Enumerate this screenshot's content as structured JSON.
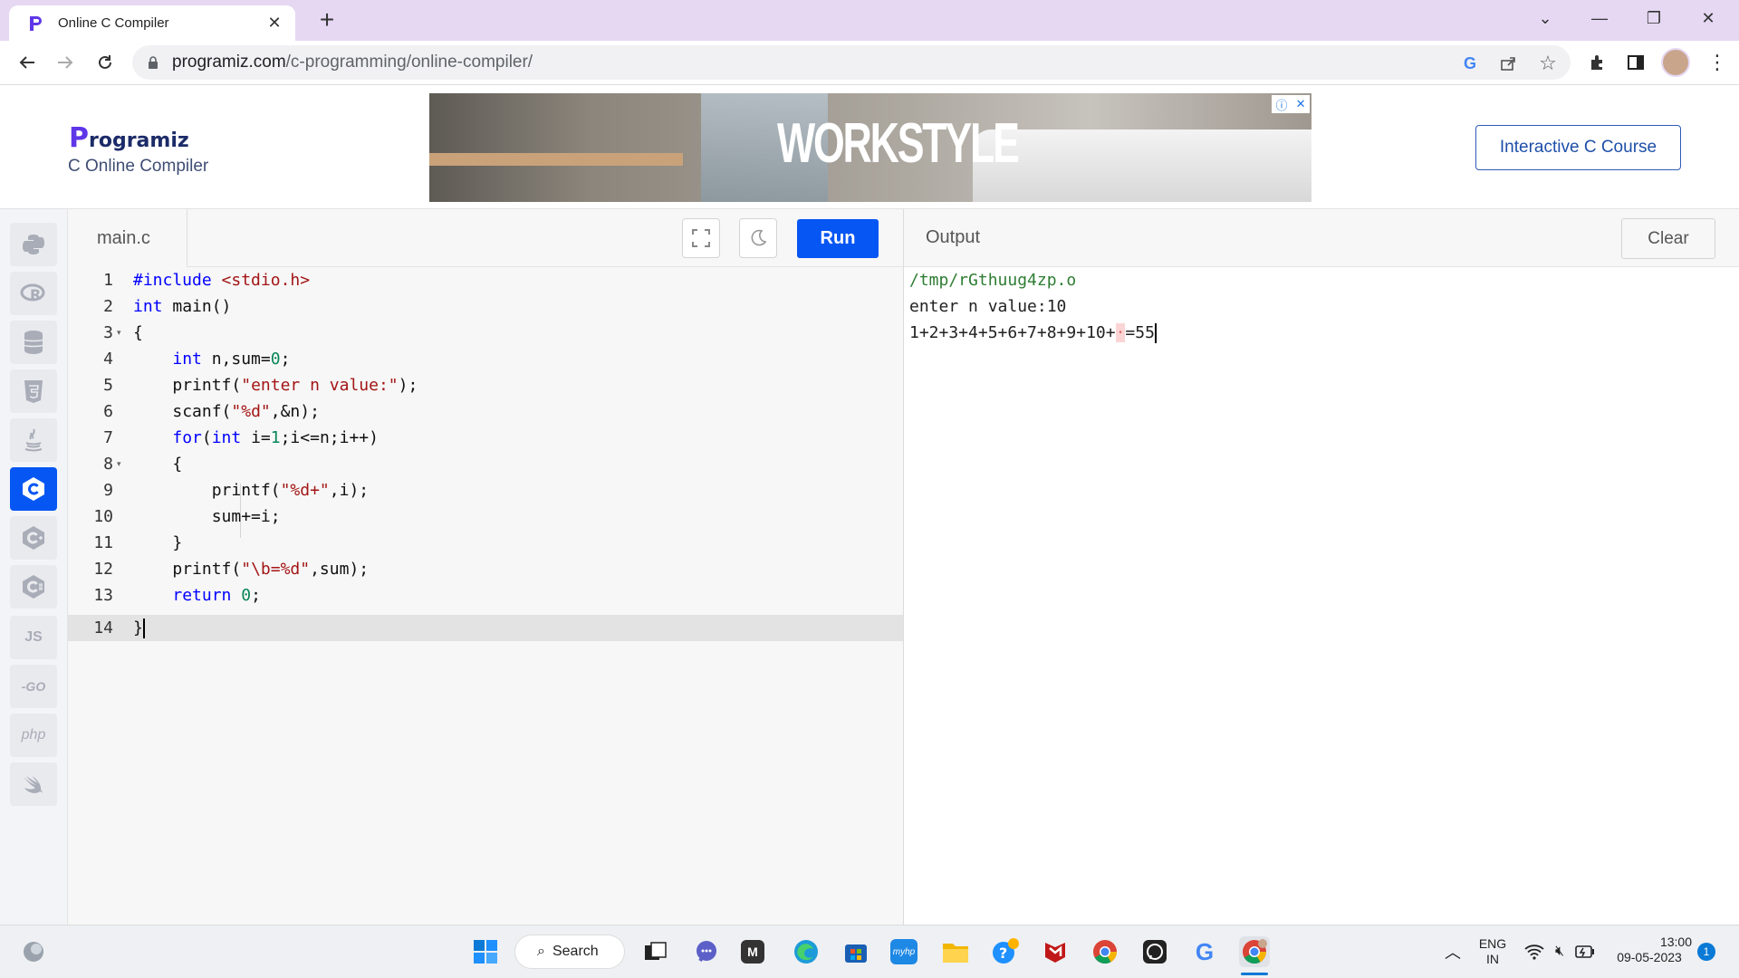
{
  "browser": {
    "tab_title": "Online C Compiler",
    "url_domain": "programiz.com",
    "url_path": "/c-programming/online-compiler/"
  },
  "site": {
    "logo_text": "rogramiz",
    "logo_letter": "P",
    "subtitle": "C Online Compiler",
    "ad_text": "WORKSTYLE",
    "course_button": "Interactive C Course"
  },
  "editor": {
    "file_name": "main.c",
    "run_label": "Run",
    "line_numbers": [
      "1",
      "2",
      "3",
      "4",
      "5",
      "6",
      "7",
      "8",
      "9",
      "10",
      "11",
      "12",
      "13",
      "14"
    ],
    "lines": [
      "#include <stdio.h>",
      "int main()",
      "{",
      "    int n,sum=0;",
      "    printf(\"enter n value:\");",
      "    scanf(\"%d\",&n);",
      "    for(int i=1;i<=n;i++)",
      "    {",
      "        printf(\"%d+\",i);",
      "        sum+=i;",
      "    }",
      "    printf(\"\\b=%d\",sum);",
      "    return 0;",
      "}"
    ]
  },
  "output": {
    "title": "Output",
    "clear_label": "Clear",
    "path_line": "/tmp/rGthuug4zp.o",
    "prompt_line": "enter n value:10",
    "result_prefix": "1+2+3+4+5+6+7+8+9+10+",
    "result_backspace": "·",
    "result_suffix": "=55"
  },
  "taskbar": {
    "search_label": "Search",
    "lang_top": "ENG",
    "lang_bottom": "IN",
    "time": "13:00",
    "date": "09-05-2023",
    "notification_count": "1"
  },
  "colors": {
    "accent": "#0556f3",
    "tabstrip": "#e6d8f3"
  }
}
